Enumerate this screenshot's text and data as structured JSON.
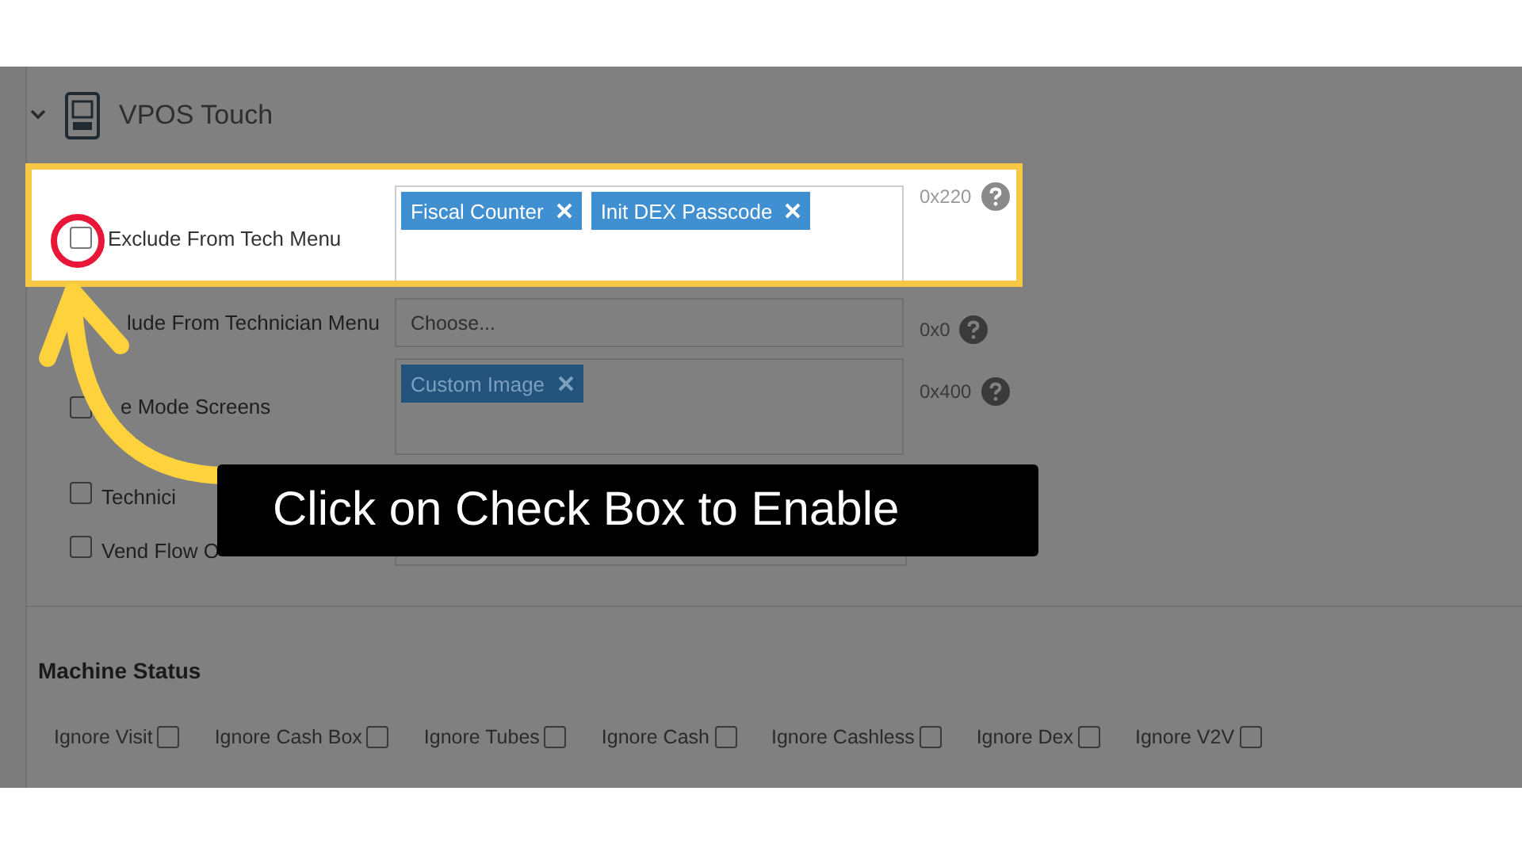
{
  "section": {
    "title": "VPOS Touch",
    "expanded": true
  },
  "settings": [
    {
      "label": "Exclude From Tech Menu",
      "checked": false,
      "highlighted": true,
      "kind": "tags",
      "tags": [
        "Fiscal Counter",
        "Init DEX Passcode"
      ],
      "code": "0x220"
    },
    {
      "label": "lude From Technician Menu",
      "highlighted": false,
      "kind": "select",
      "placeholder": "Choose...",
      "code": "0x0"
    },
    {
      "label": "e Mode Screens",
      "checked": false,
      "highlighted": false,
      "kind": "tags",
      "tags": [
        "Custom Image"
      ],
      "code": "0x400"
    },
    {
      "label": "Technici",
      "checked": false,
      "highlighted": false,
      "kind": "covered"
    },
    {
      "label": "Vend Flow O",
      "checked": false,
      "highlighted": false,
      "kind": "covered"
    }
  ],
  "annotation": {
    "text": "Click on Check Box to Enable"
  },
  "machine_status": {
    "title": "Machine Status",
    "options": [
      {
        "label": "Ignore Visit",
        "checked": false
      },
      {
        "label": "Ignore Cash Box",
        "checked": false
      },
      {
        "label": "Ignore Tubes",
        "checked": false
      },
      {
        "label": "Ignore Cash",
        "checked": false
      },
      {
        "label": "Ignore Cashless",
        "checked": false
      },
      {
        "label": "Ignore Dex",
        "checked": false
      },
      {
        "label": "Ignore V2V",
        "checked": false
      }
    ]
  }
}
